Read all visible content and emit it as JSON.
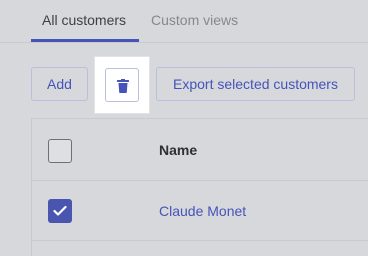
{
  "tabs": [
    {
      "label": "All customers",
      "active": true
    },
    {
      "label": "Custom views",
      "active": false
    }
  ],
  "toolbar": {
    "add_label": "Add",
    "delete_icon": "trash-icon",
    "export_label": "Export selected customers"
  },
  "table": {
    "columns": [
      "Name"
    ],
    "rows": [
      {
        "name": "Claude Monet",
        "selected": true
      }
    ]
  },
  "colors": {
    "accent": "#4653b8",
    "backdrop": "#d7d8dc",
    "highlight": "#ffffff"
  }
}
